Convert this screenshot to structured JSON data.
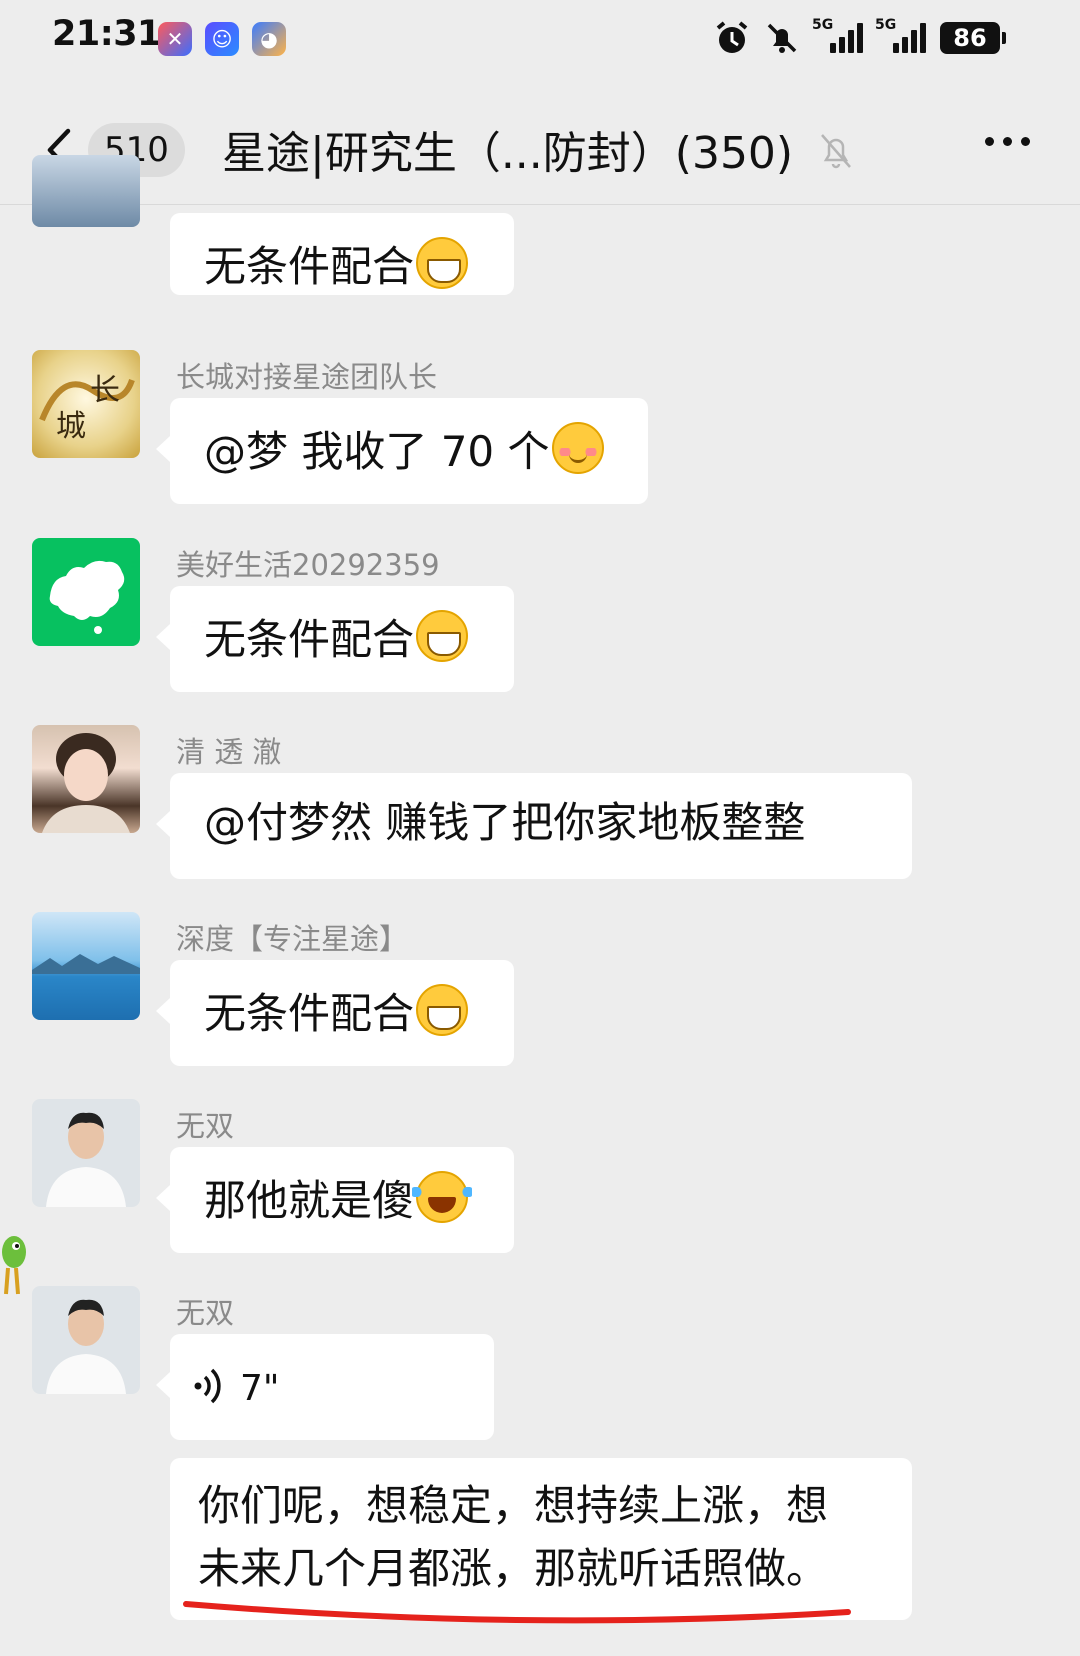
{
  "status_bar": {
    "time": "21:31",
    "signal_label_1": "5G",
    "signal_label_2": "5G",
    "battery": "86"
  },
  "nav": {
    "back_count": "510",
    "title": "星途|研究生（...防封）(350)"
  },
  "messages": [
    {
      "sender": "",
      "text": "无条件配合",
      "emoji": "grin-icon"
    },
    {
      "sender": "长城对接星途团队长",
      "text": "@梦  我收了 70 个",
      "emoji": "shy-icon",
      "avatar_text": "长城"
    },
    {
      "sender": "美好生活20292359",
      "text": "无条件配合",
      "emoji": "grin-icon"
    },
    {
      "sender": "清 透 澈",
      "text": "@付梦然  赚钱了把你家地板整整",
      "emoji": ""
    },
    {
      "sender": "深度【专注星途】",
      "text": "无条件配合",
      "emoji": "grin-icon"
    },
    {
      "sender": "无双",
      "text": "那他就是傻",
      "emoji": "laugh-icon"
    },
    {
      "sender": "无双",
      "voice_duration": "7\"",
      "transcript_line1": "你们呢，想稳定，想持续上涨，想",
      "transcript_line2": "未来几个月都涨，那就听话照做。"
    }
  ],
  "colors": {
    "background": "#ededed",
    "bubble": "#ffffff",
    "sender_text": "#8a8a8a",
    "annotation_red": "#e5221c",
    "map_green": "#07c160"
  }
}
